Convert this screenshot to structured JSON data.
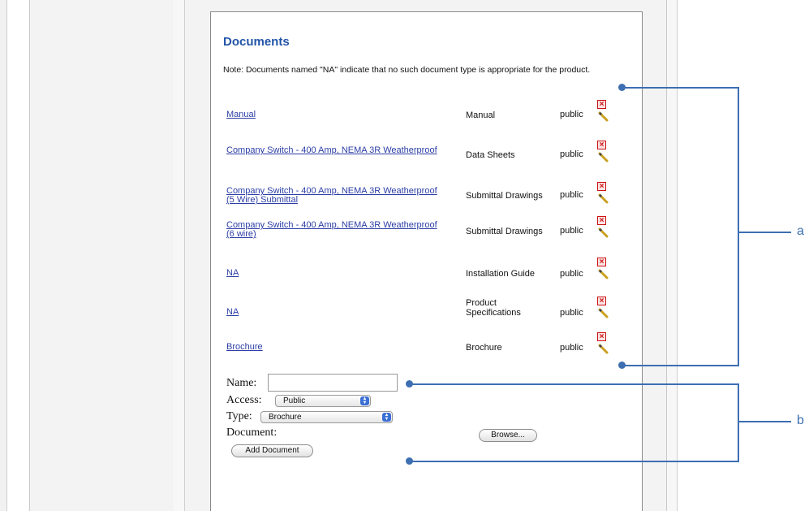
{
  "section_title": "Documents",
  "note": "Note: Documents named \"NA\" indicate that no such document type is appropriate for the product.",
  "documents": [
    {
      "name": "Manual",
      "type": "Manual",
      "access": "public"
    },
    {
      "name": "Company Switch - 400 Amp, NEMA 3R Weatherproof",
      "type": "Data Sheets",
      "access": "public"
    },
    {
      "name": "Company Switch - 400 Amp, NEMA 3R Weatherproof (5 Wire) Submittal",
      "type": "Submittal Drawings",
      "access": "public"
    },
    {
      "name": "Company Switch - 400 Amp, NEMA 3R Weatherproof (6 wire)",
      "type": "Submittal Drawings",
      "access": "public"
    },
    {
      "name": "NA",
      "type": "Installation Guide",
      "access": "public"
    },
    {
      "name": "NA",
      "type": "Product Specifications",
      "access": "public"
    },
    {
      "name": "Brochure",
      "type": "Brochure",
      "access": "public"
    }
  ],
  "form": {
    "name_label": "Name:",
    "name_value": "",
    "access_label": "Access:",
    "access_selected": "Public",
    "type_label": "Type:",
    "type_selected": "Brochure",
    "document_label": "Document:",
    "browse_button": "Browse...",
    "add_button": "Add Document"
  },
  "callouts": {
    "a": "a",
    "b": "b"
  },
  "colors": {
    "link": "#2c3ea6",
    "title": "#2255a8",
    "callout": "#3d6fb2",
    "delete": "#cc1111"
  },
  "icons": {
    "delete": "delete-x-icon",
    "edit": "pencil-icon"
  }
}
